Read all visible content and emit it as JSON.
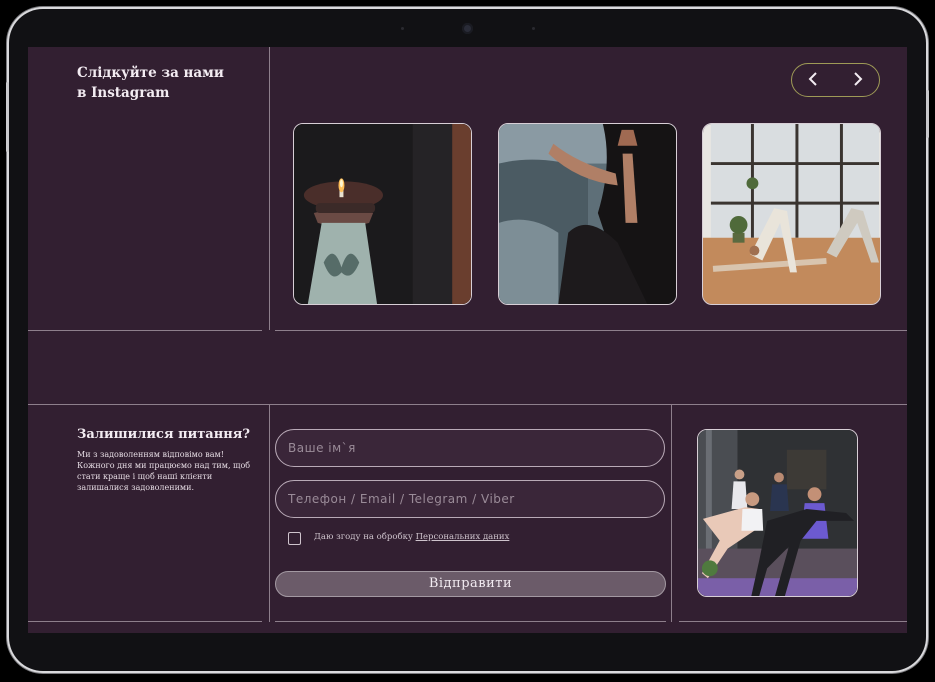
{
  "instagram": {
    "title_line1": "Слідкуйте за нами",
    "title_line2": "в Instagram",
    "prev_icon": "chevron-left-icon",
    "next_icon": "chevron-right-icon",
    "accent_color": "#9e9a56",
    "photos": [
      "candle-photo",
      "yoga-namaste-photo",
      "yoga-studio-photo"
    ]
  },
  "contact": {
    "title": "Залишилися питання?",
    "description": "Ми з задоволенням відповімо вам! Кожного дня ми працюємо над тим, щоб стати краще і щоб наші клієнти залишалися задоволеними.",
    "name_placeholder": "Ваше ім`я",
    "contact_placeholder": "Телефон / Email / Telegram / Viber",
    "consent_text": "Даю згоду на обробку ",
    "consent_link": "Персональних даних",
    "submit_label": "Відправити",
    "photo": "yoga-class-photo"
  },
  "colors": {
    "background": "#321f31",
    "divider": "#8e7f8c",
    "button": "#6b5b69"
  }
}
